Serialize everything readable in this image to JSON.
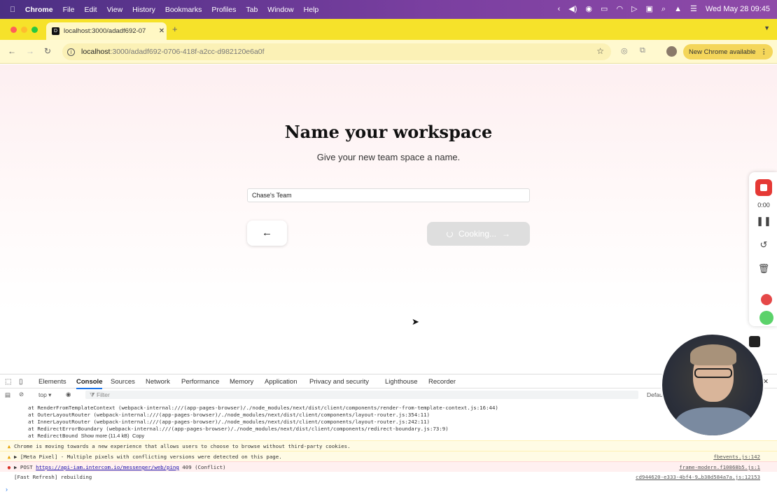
{
  "menubar": {
    "app": "Chrome",
    "items": [
      "File",
      "Edit",
      "View",
      "History",
      "Bookmarks",
      "Profiles",
      "Tab",
      "Window",
      "Help"
    ],
    "datetime": "Wed May 28  09:45"
  },
  "tab": {
    "title": "localhost:3000/adadf692-07",
    "favicon": "devin-favicon"
  },
  "address": {
    "host": "localhost",
    "path": ":3000/adadf692-0706-418f-a2cc-d982120e6a0f"
  },
  "toolbar": {
    "new_chrome": "New Chrome available"
  },
  "page": {
    "title": "Name your workspace",
    "subtitle": "Give your new team space a name.",
    "input_value": "Chase's Team",
    "back_label": "←",
    "next_label": "Cooking...",
    "next_arrow": "→"
  },
  "recorder": {
    "time": "0:00"
  },
  "devtools": {
    "tabs": [
      "Elements",
      "Console",
      "Sources",
      "Network",
      "Performance",
      "Memory",
      "Application",
      "Privacy and security",
      "Lighthouse",
      "Recorder"
    ],
    "context": "top ▾",
    "filter_placeholder": "Filter",
    "levels": "Default",
    "stack_lines": [
      "at RenderFromTemplateContext (webpack-internal:///(app-pages-browser)/./node_modules/next/dist/client/components/render-from-template-context.js:16:44)",
      "at OuterLayoutRouter (webpack-internal:///(app-pages-browser)/./node_modules/next/dist/client/components/layout-router.js:354:11)",
      "at InnerLayoutRouter (webpack-internal:///(app-pages-browser)/./node_modules/next/dist/client/components/layout-router.js:242:11)",
      "at RedirectErrorBoundary (webpack-internal:///(app-pages-browser)/./node_modules/next/dist/client/components/redirect-boundary.js:73:9)"
    ],
    "stack_last": "at RedirectBound",
    "show_more": "Show more (11.4 kB)",
    "copy": "Copy",
    "messages": [
      {
        "level": "warning",
        "text": "Chrome is moving towards a new experience that allows users to choose to browse without third-party cookies.",
        "source": ""
      },
      {
        "level": "warning",
        "text": "▶ [Meta Pixel] - Multiple pixels with conflicting versions were detected on this page.",
        "source": "fbevents.js:142"
      },
      {
        "level": "error",
        "text_prefix": "▶ POST ",
        "link": "https://api-iam.intercom.io/messenger/web/ping",
        "text_suffix": " 409 (Conflict)",
        "source": "frame-modern.f10868b5.js:1"
      },
      {
        "level": "info",
        "text": "[Fast Refresh] rebuilding",
        "source": "cd944620-e333-4bf4-9…b38d584a7a.js:12153"
      }
    ]
  },
  "colors": {
    "menubar": "#6a3a97",
    "tabbar": "#f6e22a",
    "accent": "#1a73e8",
    "stop": "#e53935"
  }
}
